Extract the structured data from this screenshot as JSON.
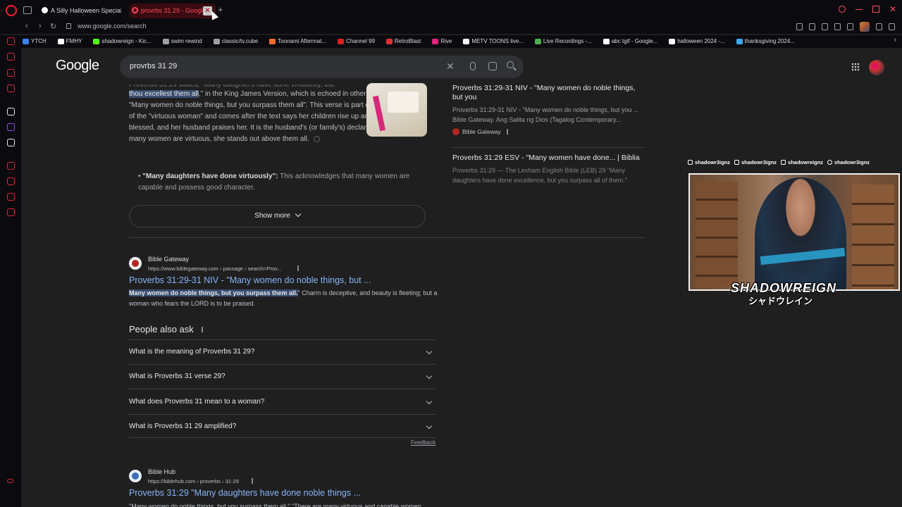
{
  "tabs": [
    {
      "title": "A Silly Halloween Special",
      "active": false
    },
    {
      "title": "provrbs 31 29 - Google",
      "active": true
    }
  ],
  "address": {
    "url": "www.google.com/search"
  },
  "bookmarks": [
    {
      "label": "YTCH",
      "color": "#3b82f6"
    },
    {
      "label": "FMHY",
      "color": "#ffffff"
    },
    {
      "label": "shadowreign - Kic...",
      "color": "#53fc18"
    },
    {
      "label": "swim rewind",
      "color": "#9aa0a6"
    },
    {
      "label": "classic/tv.cube",
      "color": "#9aa0a6"
    },
    {
      "label": "Toonami Aftermat...",
      "color": "#ff6b2c"
    },
    {
      "label": "Channel 99",
      "color": "#e02020"
    },
    {
      "label": "RetroBlast",
      "color": "#e03030"
    },
    {
      "label": "Rive",
      "color": "#e0257a"
    },
    {
      "label": "METV TOONS live...",
      "color": "#ffffff"
    },
    {
      "label": "Live Recordings -...",
      "color": "#4caf50"
    },
    {
      "label": "abc tgif - Google...",
      "color": "#ffffff"
    },
    {
      "label": "halloween 2024 -...",
      "color": "#ffffff"
    },
    {
      "label": "thanksgiving 2024...",
      "color": "#3fa9f5"
    }
  ],
  "google": {
    "logo": "Google",
    "query": "provrbs 31 29"
  },
  "snippet": {
    "cutoff": "Proverbs 31:29 states, \"Many daughters have done virtuously, but",
    "hl": "thou excellest them all",
    "text": ",\" in the King James Version, which is echoed in other translations as \"Many women do noble things, but you surpass them all\". This verse is part of the description of the \"virtuous woman\" and comes after the text says her children rise up and call her blessed, and her husband praises her. It is the husband's (or family's) declaration that while many women are virtuous, she stands out above them all.",
    "bullet_bold": "\"Many daughters have done virtuously\":",
    "bullet_text": " This acknowledges that many women are capable and possess good character.",
    "show_more": "Show more"
  },
  "right_panel": [
    {
      "title": "Proverbs 31:29-31 NIV - \"Many women do noble things, but you",
      "snippet": "Proverbs 31:29-31 NIV - \"Many women do noble things, but you ... Bible Gateway. Ang Salita ng Dios (Tagalog Contemporary...",
      "source": "Bible Gateway"
    },
    {
      "title": "Proverbs 31:29 ESV - \"Many women have done... | Biblia",
      "snippet": "Proverbs 31:29 — The Lexham English Bible (LEB) 29 \"Many daughters have done excellence, but you surpass all of them.\"",
      "source": ""
    }
  ],
  "result1": {
    "site": "Bible Gateway",
    "url": "https://www.biblegateway.com › passage › search=Prov...",
    "title": "Proverbs 31:29-31 NIV - \"Many women do noble things, but ...",
    "snippet_bold": "Many women do noble things, but you surpass them all.",
    "snippet_text": "\" Charm is deceptive, and beauty is fleeting; but a woman who fears the LORD is to be praised."
  },
  "paa": {
    "heading": "People also ask",
    "items": [
      "What is the meaning of Proverbs 31 29?",
      "What is Proverbs 31 verse 29?",
      "What does Proverbs 31 mean to a woman?",
      "What is Proverbs 31 29 amplified?"
    ],
    "feedback": "Feedback"
  },
  "result2": {
    "site": "Bible Hub",
    "url": "https://biblehub.com › proverbs › 31-29",
    "title": "Proverbs 31:29 \"Many daughters have done noble things ...",
    "snippet": "\"Many women do noble things, but you surpass them all.\" \"There are many virtuous and capable women"
  },
  "overlay": {
    "socials": [
      "shadowr3ignz",
      "shadowr3ignz",
      "shadowreignz",
      "shadowr3ignz"
    ],
    "name": "SHADOWREIGN",
    "name_jp": "シャドウレイン"
  }
}
